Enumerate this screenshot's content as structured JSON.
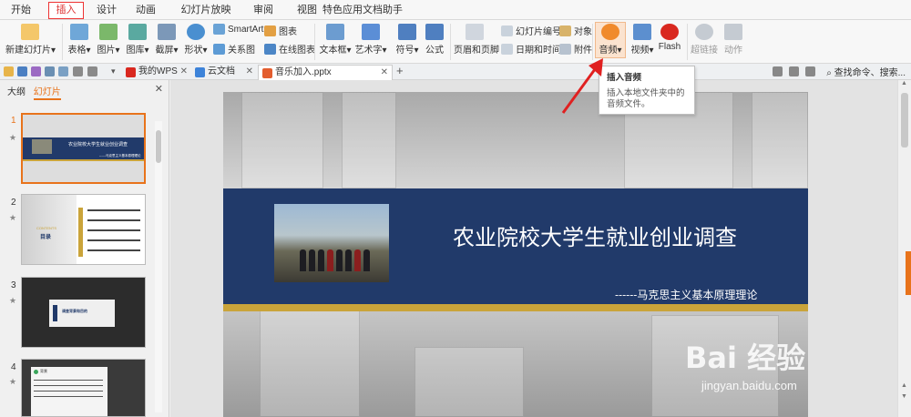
{
  "menu": [
    "开始",
    "插入",
    "设计",
    "动画",
    "幻灯片放映",
    "审阅",
    "视图",
    "特色应用",
    "文档助手"
  ],
  "ribbon": {
    "new_slide": "新建幻灯片",
    "table": "表格",
    "image": "图片",
    "gallery": "图库",
    "screenshot": "截屏",
    "shape": "形状",
    "smartart": "SmartArt",
    "chart": "图表",
    "relation": "关系图",
    "online_chart": "在线图表",
    "textbox": "文本框",
    "wordart": "艺术字",
    "symbol": "符号",
    "formula": "公式",
    "header_footer": "页眉和页脚",
    "slide_no": "幻灯片编号",
    "datetime": "日期和时间",
    "object": "对象",
    "attachment": "附件",
    "audio": "音频",
    "video": "视频",
    "flash": "Flash",
    "hyperlink": "超链接",
    "action": "动作"
  },
  "tabs": [
    "我的WPS",
    "云文档",
    "音乐加入.pptx"
  ],
  "search_label": "查找命令、搜索...",
  "left_panel": {
    "outline": "大纲",
    "slides": "幻灯片"
  },
  "slide_numbers": [
    "1",
    "2",
    "3",
    "4"
  ],
  "thumbs": {
    "t1_title": "农业院校大学生就业创业调查",
    "t1_sub": "------马克思主义基本原理理论",
    "t2_label": "目录",
    "t2_contents": "CONTENTS",
    "t3_title": "调查背景和目的",
    "t4_header": "背景"
  },
  "slide": {
    "title": "农业院校大学生就业创业调查",
    "subtitle": "------马克思主义基本原理理论"
  },
  "tooltip": {
    "title": "插入音频",
    "desc": "插入本地文件夹中的音频文件。"
  },
  "watermark": {
    "brand": "Bai  经验",
    "url": "jingyan.baidu.com"
  },
  "colors": {
    "accent": "#e8731b",
    "band": "#213a6a",
    "gold": "#caa43a",
    "arrow": "#e02020"
  }
}
